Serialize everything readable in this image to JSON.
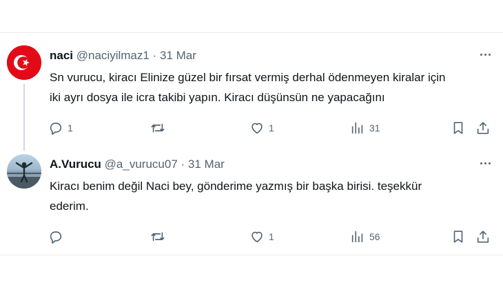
{
  "tweets": [
    {
      "name": "naci",
      "handle": "@naciyilmaz1",
      "separator": "·",
      "date": "31 Mar",
      "text_line1": "Sn vurucu, kiracı Elinize güzel bir fırsat vermiş derhal ödenmeyen kiralar için",
      "text_line2": "iki ayrı dosya ile icra takibi yapın. Kiracı düşünsün ne yapacağını",
      "reply_count": "1",
      "retweet_count": "",
      "like_count": "1",
      "view_count": "31",
      "avatar_icon": "turkish-flag-icon"
    },
    {
      "name": "A.Vurucu",
      "handle": "@a_vurucu07",
      "separator": "·",
      "date": "31 Mar",
      "text_line1": "Kiracı benim değil Naci bey, gönderime yazmış bir başka birisi. teşekkür",
      "text_line2": "ederim.",
      "reply_count": "",
      "retweet_count": "",
      "like_count": "1",
      "view_count": "56",
      "avatar_icon": "person-photo-avatar"
    }
  ],
  "colors": {
    "text": "#0f1419",
    "secondary": "#536471",
    "divider": "#e6e9eb",
    "thread_line": "#cfd9de",
    "flag_red": "#e30a17"
  }
}
